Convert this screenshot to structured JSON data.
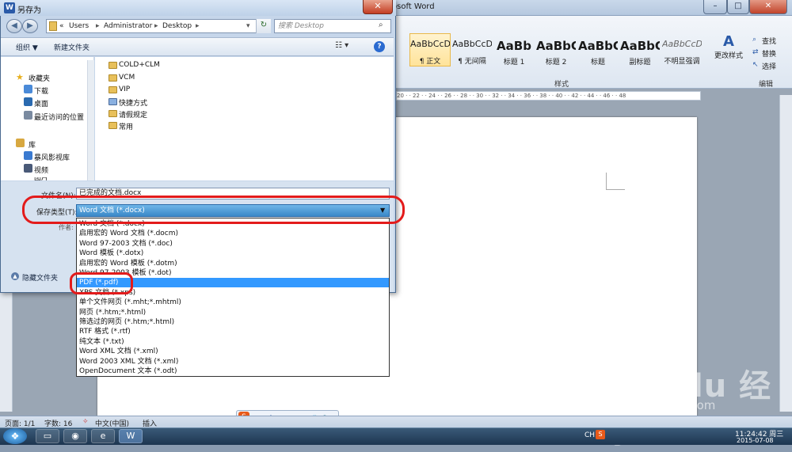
{
  "word": {
    "title_fragment": "osoft Word",
    "styles": [
      {
        "preview": "AaBbCcDd",
        "label": "¶ 正文",
        "big": false
      },
      {
        "preview": "AaBbCcDd",
        "label": "¶ 无间隔",
        "big": false
      },
      {
        "preview": "AaBb",
        "label": "标题 1",
        "big": true
      },
      {
        "preview": "AaBbC",
        "label": "标题 2",
        "big": true
      },
      {
        "preview": "AaBbC",
        "label": "标题",
        "big": true
      },
      {
        "preview": "AaBbC",
        "label": "副标题",
        "big": true
      },
      {
        "preview": "AaBbCcDd",
        "label": "不明显强调",
        "big": false
      }
    ],
    "change_styles_label": "更改样式",
    "styles_group_label": "样式",
    "edit_group_label": "编辑",
    "edit_items": [
      "查找",
      "替换",
      "选择"
    ],
    "ruler_text": "20 · · 22 · · 24 · · 26 · · 28 · · 30 · · 32 · · 34 · · 36 · · 38 · · 40 · · 42 · · 44 · · 46 · · 48",
    "status": {
      "page": "页面: 1/1",
      "words": "字数: 16",
      "lang": "中文(中国)",
      "mode": "插入"
    }
  },
  "taskbar": {
    "lang": "CH",
    "time": "11:24:42 周三",
    "date": "2015-07-08",
    "start_icon": "windows-logo-icon",
    "pinned": [
      "explorer-icon",
      "chrome-icon",
      "ie-icon",
      "word-icon"
    ]
  },
  "ime": {
    "text": "中 ☽ °, ⌨ 👕 🔧"
  },
  "watermark": {
    "main": "Bai  du 经验",
    "sub": "jingyan.baidu.com"
  },
  "dialog": {
    "title": "另存为",
    "close": "✕",
    "address": {
      "prefix": "«",
      "parts": [
        "Users",
        "Administrator",
        "Desktop"
      ]
    },
    "search_placeholder": "搜索 Desktop",
    "toolbar": {
      "organize": "组织 ▼",
      "new_folder": "新建文件夹"
    },
    "nav": {
      "favorites_head": "收藏夹",
      "favorites": [
        "下载",
        "桌面",
        "最近访问的位置"
      ],
      "libraries_head": "库",
      "libraries": [
        "暴风影视库",
        "视频",
        "图片"
      ]
    },
    "files": [
      "COLD+CLM",
      "VCM",
      "VIP",
      "快捷方式",
      "请假规定",
      "常用"
    ],
    "filename_label": "文件名(N):",
    "filename_value": "已完成的文档.docx",
    "savetype_label": "保存类型(T):",
    "savetype_value": "Word 文档 (*.docx)",
    "author_label": "作者:",
    "hide_folders": "隐藏文件夹",
    "type_options": [
      "Word 文档 (*.docx)",
      "启用宏的 Word 文档 (*.docm)",
      "Word 97-2003 文档 (*.doc)",
      "Word 模板 (*.dotx)",
      "启用宏的 Word 模板 (*.dotm)",
      "Word 97-2003 模板 (*.dot)",
      "PDF (*.pdf)",
      "XPS 文档 (*.xps)",
      "单个文件网页 (*.mht;*.mhtml)",
      "网页 (*.htm;*.html)",
      "筛选过的网页 (*.htm;*.html)",
      "RTF 格式 (*.rtf)",
      "纯文本 (*.txt)",
      "Word XML 文档 (*.xml)",
      "Word 2003 XML 文档 (*.xml)",
      "OpenDocument 文本 (*.odt)"
    ],
    "selected_option_index": 6
  },
  "colors": {
    "annotation_red": "#e31b1b",
    "selection_blue": "#3399ff"
  }
}
